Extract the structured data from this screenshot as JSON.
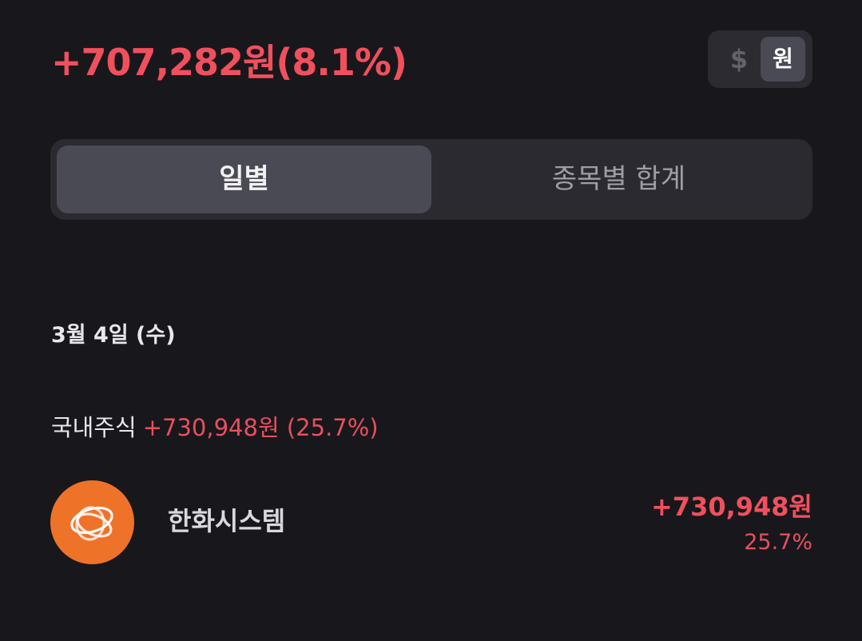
{
  "summary": {
    "total_profit": "+707,282원(8.1%)"
  },
  "currency_toggle": {
    "usd_label": "$",
    "krw_label": "원",
    "selected": "원"
  },
  "view_tabs": {
    "daily_label": "일별",
    "by_stock_label": "종목별 합계",
    "selected": "일별"
  },
  "day_section": {
    "date": "3월 4일 (수)",
    "market_label": "국내주식",
    "market_profit": "+730,948원 (25.7%)",
    "stocks": [
      {
        "name": "한화시스템",
        "profit_amount": "+730,948원",
        "profit_rate": "25.7%",
        "logo_icon": "hanwha-logo-icon"
      }
    ]
  },
  "colors": {
    "background": "#18171c",
    "profit_red": "#f0505d",
    "logo_orange": "#ef7229",
    "selected_segment": "#4a4a54"
  }
}
